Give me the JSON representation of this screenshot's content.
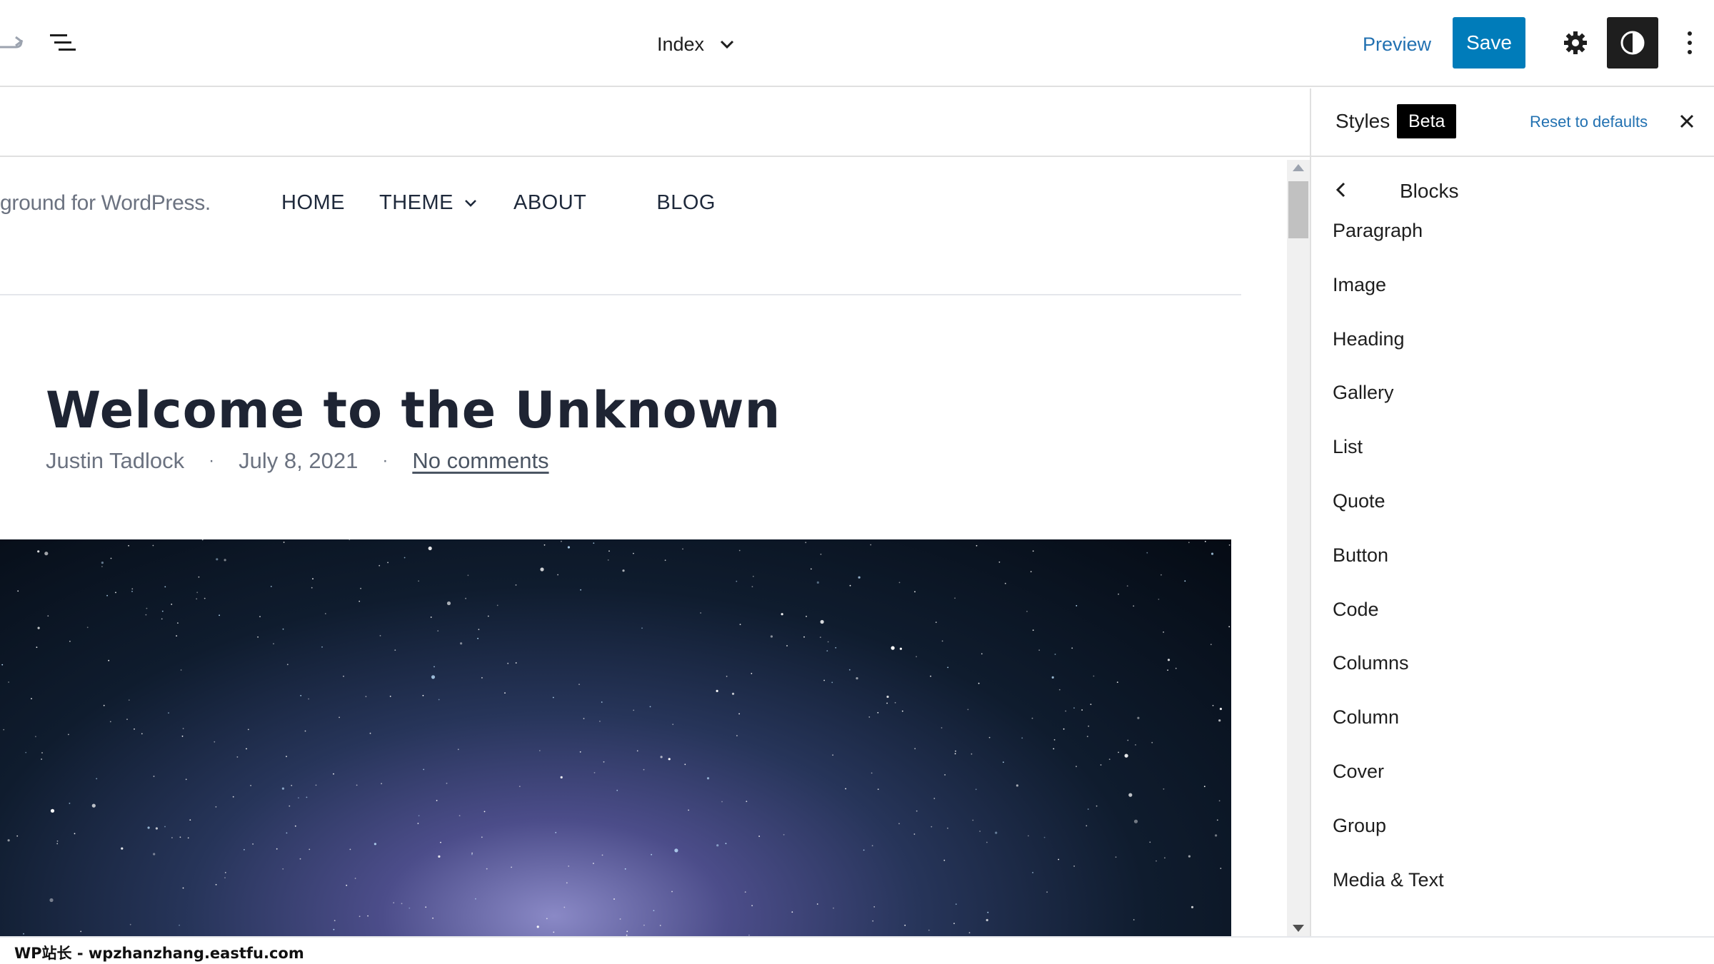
{
  "toolbar": {
    "doc_title": "Index",
    "preview_label": "Preview",
    "save_label": "Save",
    "accent_color": "#007cba",
    "icons": [
      "redo-icon",
      "list-view-icon",
      "chevron-down-icon",
      "gear-icon",
      "contrast-icon",
      "more-vertical-icon"
    ]
  },
  "site": {
    "tagline": "ground for WordPress.",
    "nav": [
      {
        "label": "HOME"
      },
      {
        "label": "THEME",
        "has_submenu": true
      },
      {
        "label": "ABOUT"
      },
      {
        "label": "BLOG"
      }
    ]
  },
  "post": {
    "title": "Welcome to the Unknown",
    "author": "Justin Tadlock",
    "date": "July 8, 2021",
    "separator": "·",
    "comments_link": "No comments",
    "featured_image": "starry night sky with milky way"
  },
  "sidebar": {
    "title": "Styles",
    "badge": "Beta",
    "reset_label": "Reset to defaults",
    "nav_title": "Blocks",
    "blocks": [
      "Paragraph",
      "Image",
      "Heading",
      "Gallery",
      "List",
      "Quote",
      "Button",
      "Code",
      "Columns",
      "Column",
      "Cover",
      "Group",
      "Media & Text"
    ]
  },
  "watermark": "WP站长 - wpzhanzhang.eastfu.com"
}
